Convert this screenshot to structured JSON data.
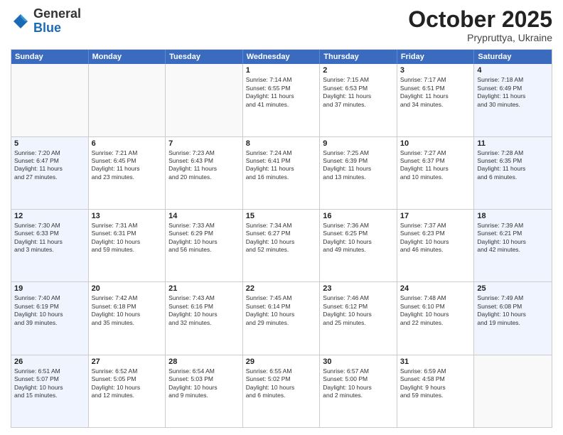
{
  "header": {
    "logo_general": "General",
    "logo_blue": "Blue",
    "month": "October 2025",
    "location": "Prypruttya, Ukraine"
  },
  "weekdays": [
    "Sunday",
    "Monday",
    "Tuesday",
    "Wednesday",
    "Thursday",
    "Friday",
    "Saturday"
  ],
  "rows": [
    [
      {
        "day": "",
        "info": "",
        "type": "empty"
      },
      {
        "day": "",
        "info": "",
        "type": "empty"
      },
      {
        "day": "",
        "info": "",
        "type": "empty"
      },
      {
        "day": "1",
        "info": "Sunrise: 7:14 AM\nSunset: 6:55 PM\nDaylight: 11 hours\nand 41 minutes.",
        "type": "normal"
      },
      {
        "day": "2",
        "info": "Sunrise: 7:15 AM\nSunset: 6:53 PM\nDaylight: 11 hours\nand 37 minutes.",
        "type": "normal"
      },
      {
        "day": "3",
        "info": "Sunrise: 7:17 AM\nSunset: 6:51 PM\nDaylight: 11 hours\nand 34 minutes.",
        "type": "normal"
      },
      {
        "day": "4",
        "info": "Sunrise: 7:18 AM\nSunset: 6:49 PM\nDaylight: 11 hours\nand 30 minutes.",
        "type": "weekend"
      }
    ],
    [
      {
        "day": "5",
        "info": "Sunrise: 7:20 AM\nSunset: 6:47 PM\nDaylight: 11 hours\nand 27 minutes.",
        "type": "weekend"
      },
      {
        "day": "6",
        "info": "Sunrise: 7:21 AM\nSunset: 6:45 PM\nDaylight: 11 hours\nand 23 minutes.",
        "type": "normal"
      },
      {
        "day": "7",
        "info": "Sunrise: 7:23 AM\nSunset: 6:43 PM\nDaylight: 11 hours\nand 20 minutes.",
        "type": "normal"
      },
      {
        "day": "8",
        "info": "Sunrise: 7:24 AM\nSunset: 6:41 PM\nDaylight: 11 hours\nand 16 minutes.",
        "type": "normal"
      },
      {
        "day": "9",
        "info": "Sunrise: 7:25 AM\nSunset: 6:39 PM\nDaylight: 11 hours\nand 13 minutes.",
        "type": "normal"
      },
      {
        "day": "10",
        "info": "Sunrise: 7:27 AM\nSunset: 6:37 PM\nDaylight: 11 hours\nand 10 minutes.",
        "type": "normal"
      },
      {
        "day": "11",
        "info": "Sunrise: 7:28 AM\nSunset: 6:35 PM\nDaylight: 11 hours\nand 6 minutes.",
        "type": "weekend"
      }
    ],
    [
      {
        "day": "12",
        "info": "Sunrise: 7:30 AM\nSunset: 6:33 PM\nDaylight: 11 hours\nand 3 minutes.",
        "type": "weekend"
      },
      {
        "day": "13",
        "info": "Sunrise: 7:31 AM\nSunset: 6:31 PM\nDaylight: 10 hours\nand 59 minutes.",
        "type": "normal"
      },
      {
        "day": "14",
        "info": "Sunrise: 7:33 AM\nSunset: 6:29 PM\nDaylight: 10 hours\nand 56 minutes.",
        "type": "normal"
      },
      {
        "day": "15",
        "info": "Sunrise: 7:34 AM\nSunset: 6:27 PM\nDaylight: 10 hours\nand 52 minutes.",
        "type": "normal"
      },
      {
        "day": "16",
        "info": "Sunrise: 7:36 AM\nSunset: 6:25 PM\nDaylight: 10 hours\nand 49 minutes.",
        "type": "normal"
      },
      {
        "day": "17",
        "info": "Sunrise: 7:37 AM\nSunset: 6:23 PM\nDaylight: 10 hours\nand 46 minutes.",
        "type": "normal"
      },
      {
        "day": "18",
        "info": "Sunrise: 7:39 AM\nSunset: 6:21 PM\nDaylight: 10 hours\nand 42 minutes.",
        "type": "weekend"
      }
    ],
    [
      {
        "day": "19",
        "info": "Sunrise: 7:40 AM\nSunset: 6:19 PM\nDaylight: 10 hours\nand 39 minutes.",
        "type": "weekend"
      },
      {
        "day": "20",
        "info": "Sunrise: 7:42 AM\nSunset: 6:18 PM\nDaylight: 10 hours\nand 35 minutes.",
        "type": "normal"
      },
      {
        "day": "21",
        "info": "Sunrise: 7:43 AM\nSunset: 6:16 PM\nDaylight: 10 hours\nand 32 minutes.",
        "type": "normal"
      },
      {
        "day": "22",
        "info": "Sunrise: 7:45 AM\nSunset: 6:14 PM\nDaylight: 10 hours\nand 29 minutes.",
        "type": "normal"
      },
      {
        "day": "23",
        "info": "Sunrise: 7:46 AM\nSunset: 6:12 PM\nDaylight: 10 hours\nand 25 minutes.",
        "type": "normal"
      },
      {
        "day": "24",
        "info": "Sunrise: 7:48 AM\nSunset: 6:10 PM\nDaylight: 10 hours\nand 22 minutes.",
        "type": "normal"
      },
      {
        "day": "25",
        "info": "Sunrise: 7:49 AM\nSunset: 6:08 PM\nDaylight: 10 hours\nand 19 minutes.",
        "type": "weekend"
      }
    ],
    [
      {
        "day": "26",
        "info": "Sunrise: 6:51 AM\nSunset: 5:07 PM\nDaylight: 10 hours\nand 15 minutes.",
        "type": "weekend"
      },
      {
        "day": "27",
        "info": "Sunrise: 6:52 AM\nSunset: 5:05 PM\nDaylight: 10 hours\nand 12 minutes.",
        "type": "normal"
      },
      {
        "day": "28",
        "info": "Sunrise: 6:54 AM\nSunset: 5:03 PM\nDaylight: 10 hours\nand 9 minutes.",
        "type": "normal"
      },
      {
        "day": "29",
        "info": "Sunrise: 6:55 AM\nSunset: 5:02 PM\nDaylight: 10 hours\nand 6 minutes.",
        "type": "normal"
      },
      {
        "day": "30",
        "info": "Sunrise: 6:57 AM\nSunset: 5:00 PM\nDaylight: 10 hours\nand 2 minutes.",
        "type": "normal"
      },
      {
        "day": "31",
        "info": "Sunrise: 6:59 AM\nSunset: 4:58 PM\nDaylight: 9 hours\nand 59 minutes.",
        "type": "normal"
      },
      {
        "day": "",
        "info": "",
        "type": "empty"
      }
    ]
  ]
}
